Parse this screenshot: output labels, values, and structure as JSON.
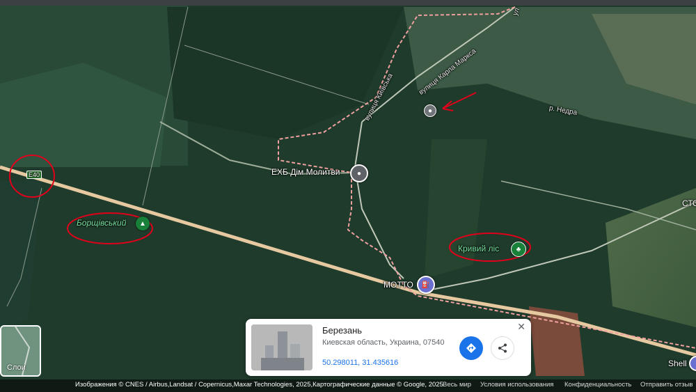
{
  "map": {
    "places": {
      "church": "ЕХБ Дім Молитви",
      "borshchivskyi": "Борщівський",
      "kryvyi_lis": "Кривий ліс",
      "motto": "МОТТО",
      "shell": "Shell",
      "sto": "СТО"
    },
    "streets": {
      "kyivska": "вулиця Київська",
      "karla_marksa": "вулиця Карла Маркса",
      "river": "р. Недра",
      "ul": "ул"
    },
    "highway_shield": "E40",
    "layers_label": "Слои"
  },
  "card": {
    "title": "Березань",
    "address": "Киевская область, Украина, 07540",
    "coords": "50.298011, 31.435616",
    "close_glyph": "✕"
  },
  "footer": {
    "attribution": "Изображения © CNES / Airbus,Landsat / Copernicus,Maxar Technologies, 2025,Картографические данные © Google, 2025",
    "scale": "Весь мир",
    "terms": "Условия использования",
    "privacy": "Конфиденциальность",
    "feedback": "Отправить отзыв"
  },
  "colors": {
    "boundary": "#f0a0a0",
    "highway": "#e6c9a0",
    "annotation": "#e0001b",
    "directions": "#1a73e8"
  },
  "icons": [
    "pin-icon",
    "fuel-icon",
    "park-icon",
    "forest-icon",
    "directions-icon",
    "share-icon",
    "close-icon",
    "layers-icon"
  ]
}
